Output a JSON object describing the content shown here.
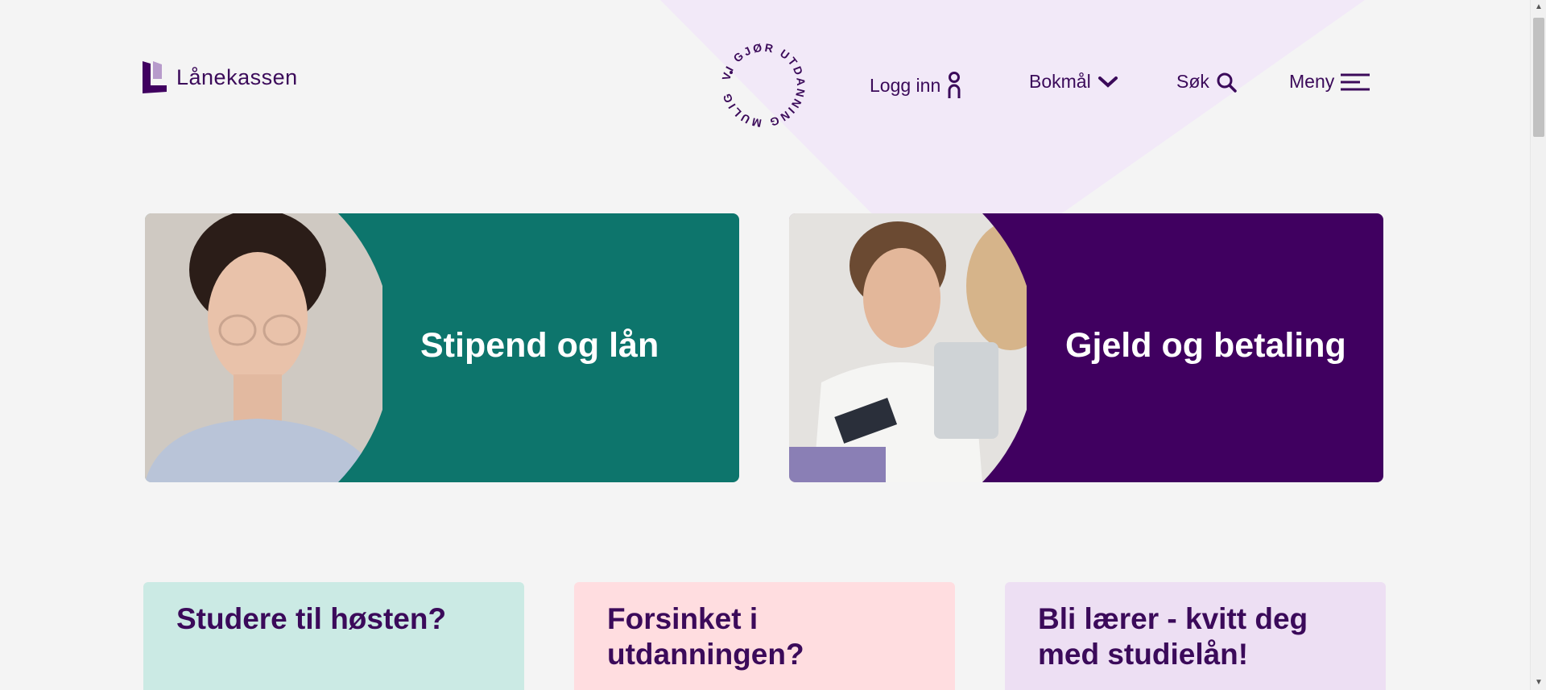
{
  "header": {
    "logo_text": "Lånekassen",
    "seal_text": "VI GJØR UTDANNING MULIG",
    "nav": {
      "login_label": "Logg inn",
      "login_icon": "person-icon",
      "language_label": "Bokmål",
      "language_icon": "chevron-down-icon",
      "search_label": "Søk",
      "search_icon": "search-icon",
      "menu_label": "Meny",
      "menu_icon": "hamburger-icon"
    }
  },
  "hero_cards": [
    {
      "title": "Stipend og lån",
      "color": "#0d756c"
    },
    {
      "title": "Gjeld og betaling",
      "color": "#400060"
    }
  ],
  "teaser_cards": [
    {
      "title": "Studere til høsten?",
      "color": "#cbeae4"
    },
    {
      "title": "Forsinket i utdanningen?",
      "color": "#ffdde0"
    },
    {
      "title": "Bli lærer - kvitt deg med studielån!",
      "color": "#eddff3"
    }
  ],
  "colors": {
    "brand_purple": "#3b0a5a",
    "background": "#f4f4f4",
    "triangle": "#f2e9f8"
  }
}
